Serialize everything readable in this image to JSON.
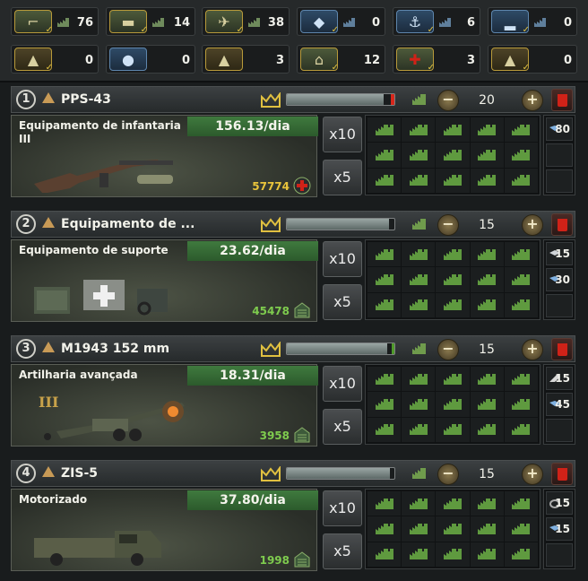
{
  "stockpile": {
    "row1": [
      {
        "icon": "infantry-equipment-icon",
        "value": "76"
      },
      {
        "icon": "tank-icon",
        "value": "14"
      },
      {
        "icon": "fighter-plane-icon",
        "value": "38"
      },
      {
        "icon": "naval-ship-icon",
        "value": "0"
      },
      {
        "icon": "anchor-icon",
        "value": "6"
      },
      {
        "icon": "convoy-ship-icon",
        "value": "0"
      }
    ],
    "row2": [
      {
        "icon": "support-up-arrow-icon",
        "value": "0"
      },
      {
        "icon": "water-drop-icon",
        "value": "0"
      },
      {
        "icon": "up-arrow-icon",
        "value": "3"
      },
      {
        "icon": "garage-icon",
        "value": "12"
      },
      {
        "icon": "medical-cross-icon",
        "value": "3"
      },
      {
        "icon": "artillery-up-icon",
        "value": "0"
      }
    ]
  },
  "lines": [
    {
      "number": "1",
      "name": "PPS-43",
      "count": "20",
      "progress": 0.9,
      "progress_end": "red",
      "equip_type": "Equipamento de infantaria III",
      "rate": "156.13/dia",
      "stock": "57774",
      "stock_color": "yellow",
      "stock_icon": "medical-cross-icon",
      "x10": "x10",
      "x5": "x5",
      "resources": [
        {
          "icon": "steel-icon",
          "value": "80"
        }
      ]
    },
    {
      "number": "2",
      "name": "Equipamento de ...",
      "count": "15",
      "progress": 0.95,
      "progress_end": "none",
      "equip_type": "Equipamento de suporte",
      "rate": "23.62/dia",
      "stock": "45478",
      "stock_color": "green",
      "stock_icon": "garage-icon",
      "x10": "x10",
      "x5": "x5",
      "resources": [
        {
          "icon": "aluminium-icon",
          "value": "15"
        },
        {
          "icon": "steel-icon",
          "value": "30"
        }
      ]
    },
    {
      "number": "3",
      "name": "M1943 152 mm",
      "count": "15",
      "progress": 0.93,
      "progress_end": "green",
      "equip_type": "Artilharia avançada",
      "rate": "18.31/dia",
      "stock": "3958",
      "stock_color": "green",
      "stock_icon": "garage-icon",
      "x10": "x10",
      "x5": "x5",
      "tier": "III",
      "resources": [
        {
          "icon": "tungsten-icon",
          "value": "15"
        },
        {
          "icon": "steel-icon",
          "value": "45"
        }
      ]
    },
    {
      "number": "4",
      "name": "ZIS-5",
      "count": "15",
      "progress": 0.96,
      "progress_end": "none",
      "equip_type": "Motorizado",
      "rate": "37.80/dia",
      "stock": "1998",
      "stock_color": "green",
      "stock_icon": "garage-icon",
      "x10": "x10",
      "x5": "x5",
      "resources": [
        {
          "icon": "rubber-icon",
          "value": "15"
        },
        {
          "icon": "steel-icon",
          "value": "15"
        }
      ]
    }
  ],
  "colors": {
    "rate_bg": "#3f7a3e",
    "stock_yellow": "#e9c43b",
    "stock_green": "#7ecb4e",
    "delete_red": "#d02218"
  }
}
